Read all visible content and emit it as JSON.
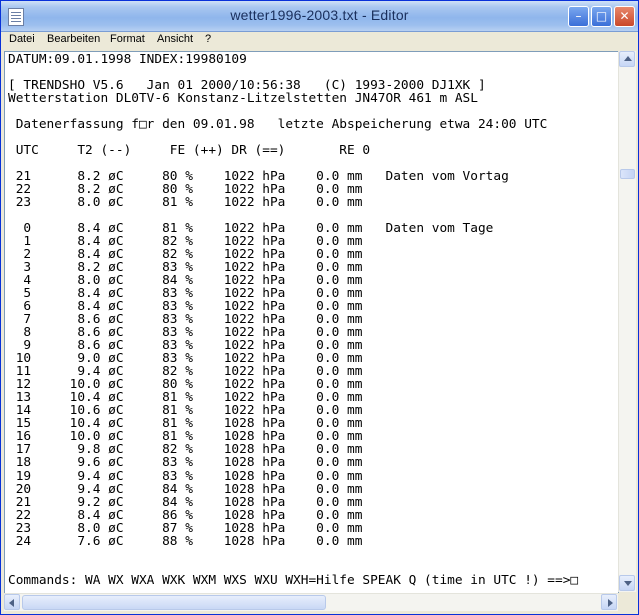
{
  "window": {
    "title": "wetter1996-2003.txt - Editor"
  },
  "menu": [
    "Datei",
    "Bearbeiten",
    "Format",
    "Ansicht",
    "?"
  ],
  "document": {
    "lines": [
      "DATUM:09.01.1998 INDEX:19980109",
      "",
      "[ TRENDSHO V5.6   Jan 01 2000/10:56:38   (C) 1993-2000 DJ1XK ]",
      "Wetterstation DL0TV-6 Konstanz-Litzelstetten JN47OR 461 m ASL",
      "",
      " Datenerfassung f□r den 09.01.98   letzte Abspeicherung etwa 24:00 UTC",
      "",
      " UTC     T2 (--)     FE (++) DR (==)       RE 0",
      "",
      " 21      8.2 øC     80 %    1022 hPa    0.0 mm   Daten vom Vortag",
      " 22      8.2 øC     80 %    1022 hPa    0.0 mm",
      " 23      8.0 øC     81 %    1022 hPa    0.0 mm",
      "",
      "  0      8.4 øC     81 %    1022 hPa    0.0 mm   Daten vom Tage",
      "  1      8.4 øC     82 %    1022 hPa    0.0 mm",
      "  2      8.4 øC     82 %    1022 hPa    0.0 mm",
      "  3      8.2 øC     83 %    1022 hPa    0.0 mm",
      "  4      8.0 øC     84 %    1022 hPa    0.0 mm",
      "  5      8.4 øC     83 %    1022 hPa    0.0 mm",
      "  6      8.4 øC     83 %    1022 hPa    0.0 mm",
      "  7      8.6 øC     83 %    1022 hPa    0.0 mm",
      "  8      8.6 øC     83 %    1022 hPa    0.0 mm",
      "  9      8.6 øC     83 %    1022 hPa    0.0 mm",
      " 10      9.0 øC     83 %    1022 hPa    0.0 mm",
      " 11      9.4 øC     82 %    1022 hPa    0.0 mm",
      " 12     10.0 øC     80 %    1022 hPa    0.0 mm",
      " 13     10.4 øC     81 %    1022 hPa    0.0 mm",
      " 14     10.6 øC     81 %    1022 hPa    0.0 mm",
      " 15     10.4 øC     81 %    1028 hPa    0.0 mm",
      " 16     10.0 øC     81 %    1028 hPa    0.0 mm",
      " 17      9.8 øC     82 %    1028 hPa    0.0 mm",
      " 18      9.6 øC     83 %    1028 hPa    0.0 mm",
      " 19      9.4 øC     83 %    1028 hPa    0.0 mm",
      " 20      9.4 øC     84 %    1028 hPa    0.0 mm",
      " 21      9.2 øC     84 %    1028 hPa    0.0 mm",
      " 22      8.4 øC     86 %    1028 hPa    0.0 mm",
      " 23      8.0 øC     87 %    1028 hPa    0.0 mm",
      " 24      7.6 øC     88 %    1028 hPa    0.0 mm",
      "",
      "",
      "Commands: WA WX WXA WXK WXM WXS WXU WXH=Hilfe SPEAK Q (time in UTC !) ==>□"
    ]
  }
}
